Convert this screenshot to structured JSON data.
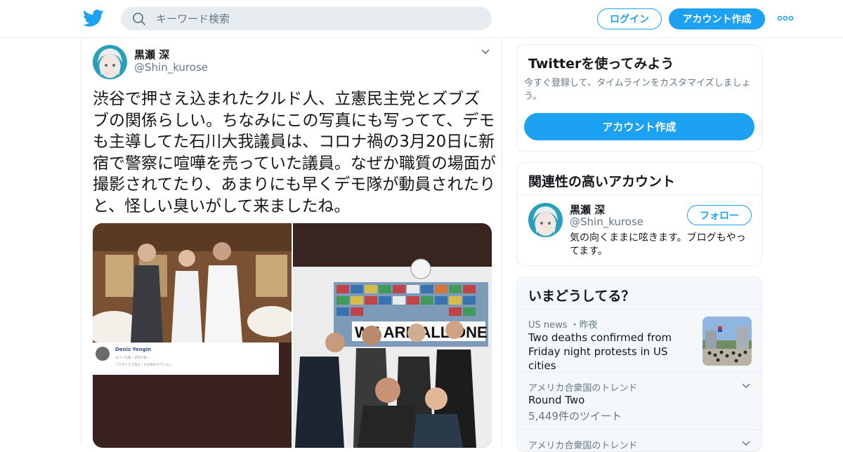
{
  "header": {
    "search_placeholder": "キーワード検索",
    "login_label": "ログイン",
    "signup_label": "アカウント作成"
  },
  "tweet": {
    "author_name": "黒瀬 深",
    "author_handle": "@Shin_kurose",
    "text": "渋谷で押さえ込まれたクルド人、立憲民主党とズブズブの関係らしい。ちなみにこの写真にも写ってて、デモも主導してた石川大我議員は、コロナ禍の3月20日に新宿で警察に喧嘩を売っていた議員。なぜか職質の場面が撮影されてたり、あまりにも早くデモ隊が動員されたりと、怪しい臭いがして来ましたね。",
    "photo_left": {
      "card_name": "Deniz Yengin",
      "card_sub": "カバー写真・3月27日・",
      "card_sub2": "フルサイズで見る・その他のオプション"
    },
    "photo_right": {
      "banner_text": "WE ARE ALL ONE"
    }
  },
  "signup_card": {
    "title": "Twitterを使ってみよう",
    "description": "今すぐ登録して、タイムラインをカスタマイズしましょう。",
    "button_label": "アカウント作成"
  },
  "related_card": {
    "title": "関連性の高いアカウント",
    "name": "黒瀬 深",
    "handle": "@Shin_kurose",
    "bio": "気の向くままに呟きます。ブログもやってます。",
    "follow_label": "フォロー"
  },
  "trends_card": {
    "title": "いまどうしてる？",
    "items": [
      {
        "meta": "US news ・昨夜",
        "headline": "Two deaths confirmed from Friday night protests in US cities"
      },
      {
        "meta": "アメリカ合衆国のトレンド",
        "name": "Round Two",
        "count": "5,449件のツイート"
      },
      {
        "meta": "アメリカ合衆国のトレンド"
      }
    ]
  },
  "colors": {
    "accent": "#1da1f2",
    "text": "#14171a",
    "muted": "#657786",
    "border": "#e6ecf0"
  },
  "icons": [
    "twitter-bird-icon",
    "search-icon",
    "more-dots-icon",
    "chevron-down-icon"
  ]
}
